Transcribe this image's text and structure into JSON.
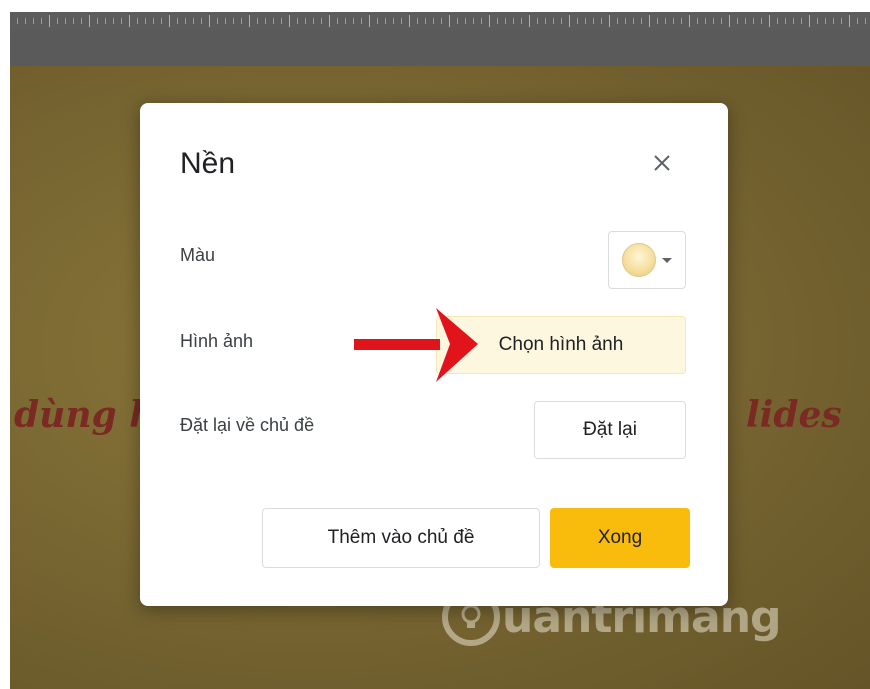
{
  "slide": {
    "text_left": "dùng hiệ",
    "text_right": "lides"
  },
  "watermark": {
    "brand": "uantrimang"
  },
  "dialog": {
    "title": "Nền",
    "close_icon": "close-icon",
    "color": {
      "label": "Màu",
      "swatch_color": "#f6dfa0"
    },
    "image": {
      "label": "Hình ảnh",
      "button_label": "Chọn hình ảnh"
    },
    "reset": {
      "label": "Đặt lại về chủ đề",
      "button_label": "Đặt lại"
    },
    "footer": {
      "add_to_theme_label": "Thêm vào chủ đề",
      "done_label": "Xong"
    }
  },
  "colors": {
    "done_button": "#f9bc0c",
    "choose_button_bg": "#fef7e0",
    "arrow": "#e2141b",
    "slide_text": "#7a2a22"
  }
}
